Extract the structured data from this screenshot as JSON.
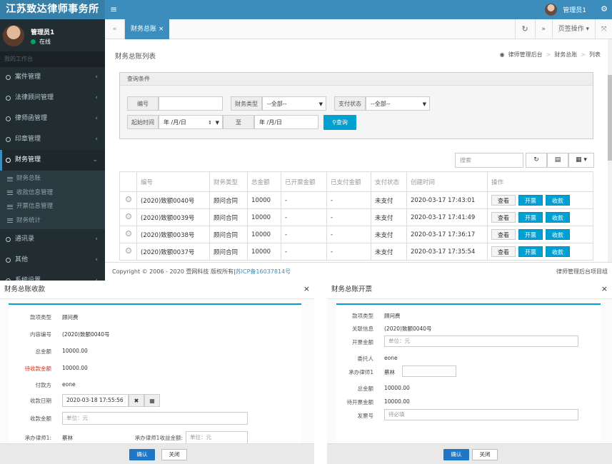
{
  "header": {
    "logo": "江苏致达律师事务所",
    "user_name": "管理员1"
  },
  "sidebar": {
    "user_name": "管理员1",
    "status": "在线",
    "section_header": "我的工作台",
    "menu": [
      {
        "label": "案件管理"
      },
      {
        "label": "法律顾问管理"
      },
      {
        "label": "律师函管理"
      },
      {
        "label": "印章管理"
      },
      {
        "label": "财务管理"
      }
    ],
    "submenu": [
      {
        "label": "财务总账"
      },
      {
        "label": "收款信息管理"
      },
      {
        "label": "开票信息管理"
      },
      {
        "label": "财务统计"
      }
    ],
    "menu_after": [
      {
        "label": "通讯录"
      },
      {
        "label": "其他"
      },
      {
        "label": "系统设置"
      }
    ]
  },
  "tabbar": {
    "active_tab": "财务总账",
    "tab_ops": "页签操作"
  },
  "page": {
    "title": "财务总账列表",
    "breadcrumb": [
      "律师管理后台",
      "财务总账",
      "列表"
    ]
  },
  "query": {
    "title": "查询条件",
    "number_label": "编号",
    "type_label": "财务类型",
    "type_value": "--全部--",
    "pay_label": "支付状态",
    "pay_value": "--全部--",
    "start_label": "起始时间",
    "date_placeholder": "年 /月/日",
    "to_label": "至",
    "query_button": "查询"
  },
  "tools": {
    "search_placeholder": "搜索"
  },
  "table": {
    "columns": [
      "编号",
      "财务类型",
      "总金额",
      "已开票金额",
      "已支付金额",
      "支付状态",
      "创建时间",
      "操作"
    ],
    "rows": [
      {
        "id": "(2020)致额0040号",
        "type": "顾问合同",
        "total": "10000",
        "invoiced": "-",
        "paid": "-",
        "status": "未支付",
        "created": "2020-03-17 17:43:01"
      },
      {
        "id": "(2020)致额0039号",
        "type": "顾问合同",
        "total": "10000",
        "invoiced": "-",
        "paid": "-",
        "status": "未支付",
        "created": "2020-03-17 17:41:49"
      },
      {
        "id": "(2020)致额0038号",
        "type": "顾问合同",
        "total": "10000",
        "invoiced": "-",
        "paid": "-",
        "status": "未支付",
        "created": "2020-03-17 17:36:17"
      },
      {
        "id": "(2020)致额0037号",
        "type": "顾问合同",
        "total": "10000",
        "invoiced": "-",
        "paid": "-",
        "status": "未支付",
        "created": "2020-03-17 17:35:54"
      }
    ],
    "actions": [
      "查看",
      "开票",
      "收款"
    ]
  },
  "footer": {
    "copyright": "Copyright © 2006 - 2020 壹网科技 版权所有|",
    "icp": "苏ICP备16037814号",
    "brand": "律师管理后台项目组"
  },
  "modal_receipt": {
    "title": "财务总账收款",
    "fields": [
      {
        "label": "款项类型",
        "value": "顾问费"
      },
      {
        "label": "内容编号",
        "value": "(2020)致额0040号"
      },
      {
        "label": "总金额",
        "value": "10000.00"
      },
      {
        "label": "待收款金额",
        "value": "10000.00"
      },
      {
        "label": "付款方",
        "value": "eone"
      }
    ],
    "date_label": "收款日期",
    "date_value": "2020-03-18 17:55:56",
    "amount_label": "收款金额",
    "amount_placeholder": "单位：元",
    "lawyer_label": "承办律师1:",
    "lawyer_value": "蔡林",
    "lawyer_amount_label": "承办律师1收益金额:",
    "lawyer_amount_placeholder": "单位：元",
    "ok": "确认",
    "cancel": "关闭"
  },
  "modal_invoice": {
    "title": "财务总账开票",
    "type_label": "款项类型",
    "type_value": "顾问费",
    "link_label": "关联信息",
    "link_value": "(2020)致额0040号",
    "amount_label": "开票金额",
    "amount_placeholder": "单位：元",
    "client_label": "委托人",
    "client_value": "eone",
    "lawyer_label": "承办律师1",
    "lawyer_value": "蔡林",
    "total_label": "总金额",
    "total_value": "10000.00",
    "pending_label": "待开票金额",
    "pending_value": "10000.00",
    "invoice_label": "发票号",
    "invoice_placeholder": "待必填",
    "ok": "确认",
    "cancel": "关闭"
  },
  "colors": {
    "header_blue": "#3c8dbc",
    "sidebar_dark": "#222d32",
    "button_blue": "#00a0d2",
    "warning_red": "#d9341a"
  }
}
